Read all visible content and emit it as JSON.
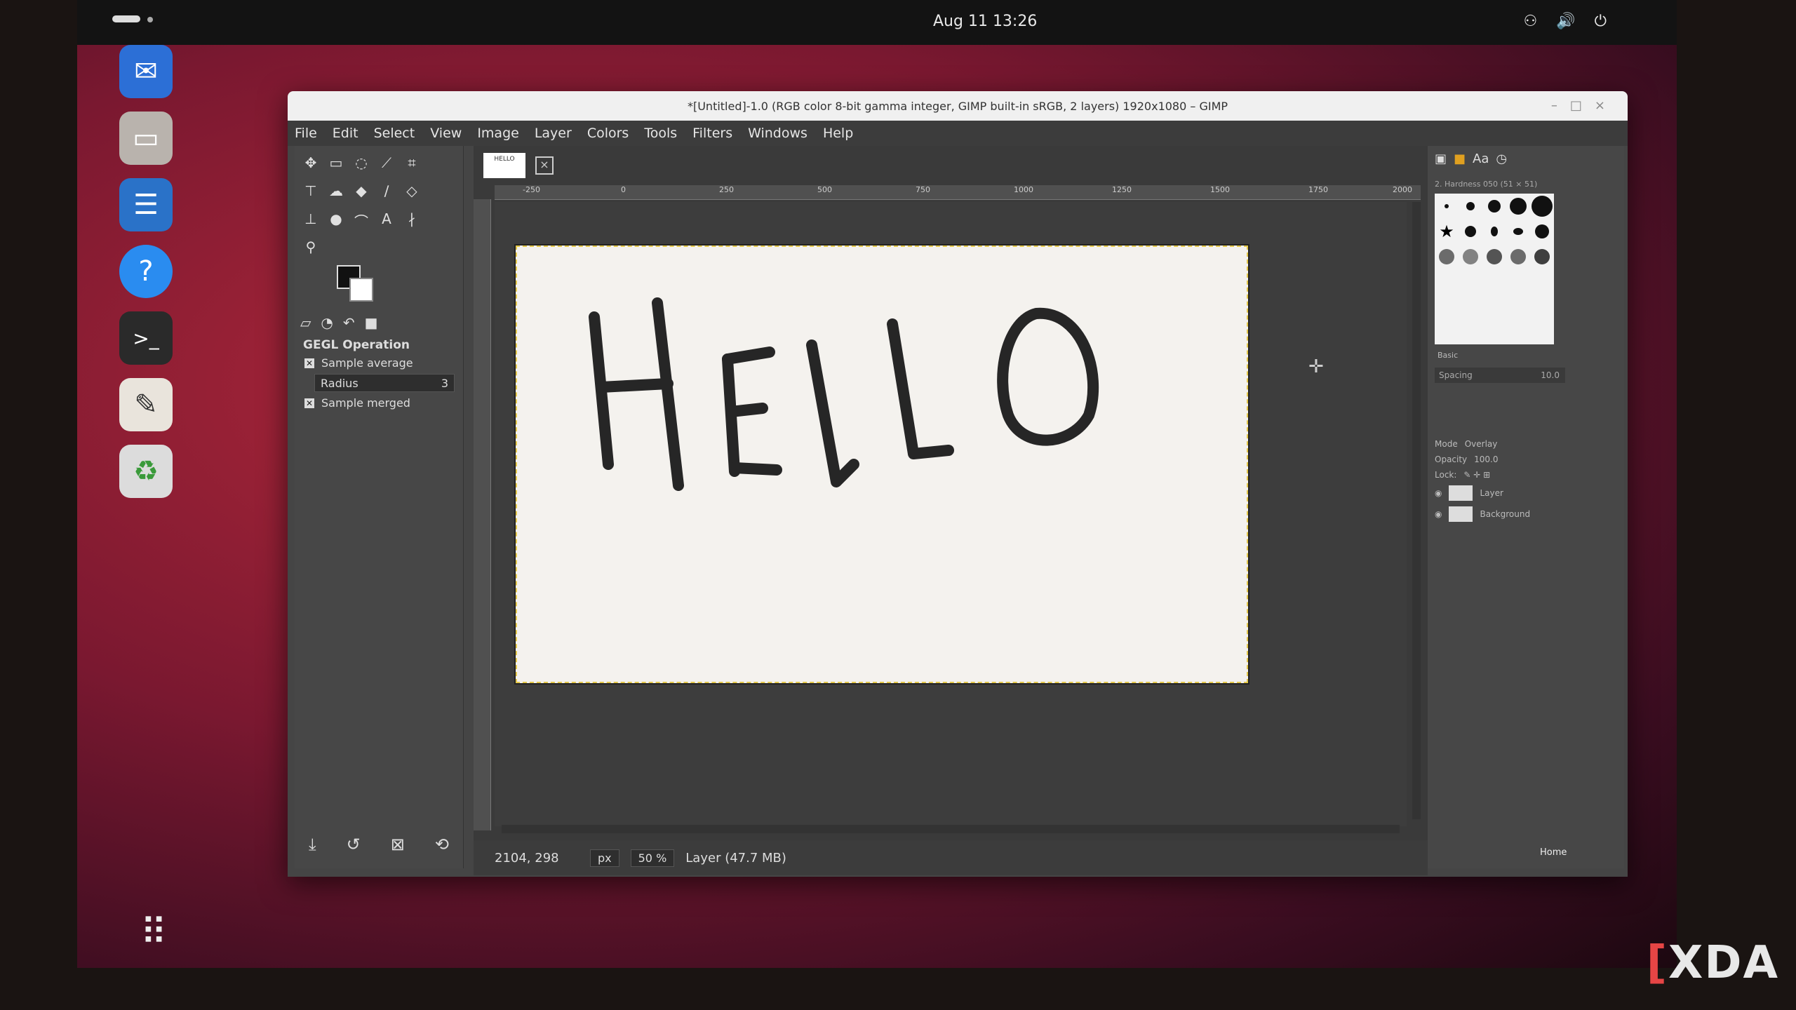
{
  "topbar": {
    "clock": "Aug 11  13:26",
    "tray_icons": "⚇ 🔊 ⏻"
  },
  "dock": {
    "apps": [
      {
        "name": "thunderbird",
        "glyph": "✉",
        "color": "#2c6fd6"
      },
      {
        "name": "files",
        "glyph": "▭",
        "color": "#c9c4bf"
      },
      {
        "name": "writer",
        "glyph": "☰",
        "color": "#2a72c8"
      },
      {
        "name": "help",
        "glyph": "?",
        "color": "#2a8cf0"
      },
      {
        "name": "terminal",
        "glyph": ">_",
        "color": "#2a2a2a"
      },
      {
        "name": "gimp",
        "glyph": "✎",
        "color": "#e9e4dc"
      },
      {
        "name": "trash",
        "glyph": "♻",
        "color": "#dcdcdc"
      }
    ],
    "app_grid_glyph": "⠿"
  },
  "window": {
    "title": "*[Untitled]-1.0 (RGB color 8-bit gamma integer, GIMP built-in sRGB, 2 layers) 1920x1080 – GIMP"
  },
  "menu": [
    "File",
    "Edit",
    "Select",
    "View",
    "Image",
    "Layer",
    "Colors",
    "Tools",
    "Filters",
    "Windows",
    "Help"
  ],
  "tool_options": {
    "title": "GEGL Operation",
    "sample_average": "Sample average",
    "radius_label": "Radius",
    "radius_value": "3",
    "sample_merged": "Sample merged"
  },
  "canvas": {
    "text": "HELLO",
    "ruler_labels": [
      "-250",
      "0",
      "250",
      "500",
      "750",
      "1000",
      "1250",
      "1500",
      "1750",
      "2000"
    ]
  },
  "statusbar": {
    "coords": "2104, 298",
    "unit": "px",
    "zoom": "50 %",
    "layer_info": "Layer (47.7 MB)"
  },
  "right_dock": {
    "brush_label": "2. Hardness 050 (51 × 51)",
    "brush_category": "Basic",
    "spacing_label": "Spacing",
    "spacing_value": "10.0",
    "mode_label": "Mode",
    "mode_value": "Overlay",
    "opacity_label": "Opacity",
    "opacity_value": "100.0",
    "lock_label": "Lock:",
    "layers": [
      "Layer",
      "Background"
    ],
    "home_label": "Home"
  },
  "watermark": {
    "bracket": "[",
    "text": "XDA"
  }
}
